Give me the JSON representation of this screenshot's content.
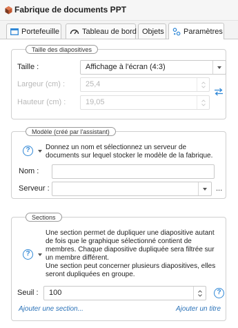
{
  "app": {
    "title": "Fabrique de documents PPT"
  },
  "tabs": [
    {
      "label": "Portefeuille"
    },
    {
      "label": "Tableau de bord"
    },
    {
      "label": "Objets"
    },
    {
      "label": "Paramètres"
    }
  ],
  "slide_size": {
    "legend": "Taille des diapositives",
    "size_label": "Taille :",
    "size_value": "Affichage à l'écran (4:3)",
    "width_label": "Largeur (cm) :",
    "width_value": "25,4",
    "height_label": "Hauteur (cm) :",
    "height_value": "19,05"
  },
  "model": {
    "legend": "Modèle (créé par l'assistant)",
    "description": "Donnez un nom et sélectionnez un serveur de documents sur lequel stocker le modèle de la fabrique.",
    "name_label": "Nom :",
    "name_value": "",
    "server_label": "Serveur :",
    "server_value": "",
    "more_label": "..."
  },
  "sections": {
    "legend": "Sections",
    "description_1": "Une section permet de dupliquer une diapositive autant de fois que le graphique sélectionné contient de membres. Chaque diapositive dupliquée sera filtrée sur un membre différent.",
    "description_2": "Une section peut concerner plusieurs diapositives, elles seront dupliquées en groupe.",
    "threshold_label": "Seuil :",
    "threshold_value": "100",
    "add_section_label": "Ajouter une section...",
    "add_title_label": "Ajouter un titre"
  },
  "colors": {
    "accent": "#2f87d6",
    "link": "#2a72b8",
    "app_icon": "#c0562f"
  }
}
